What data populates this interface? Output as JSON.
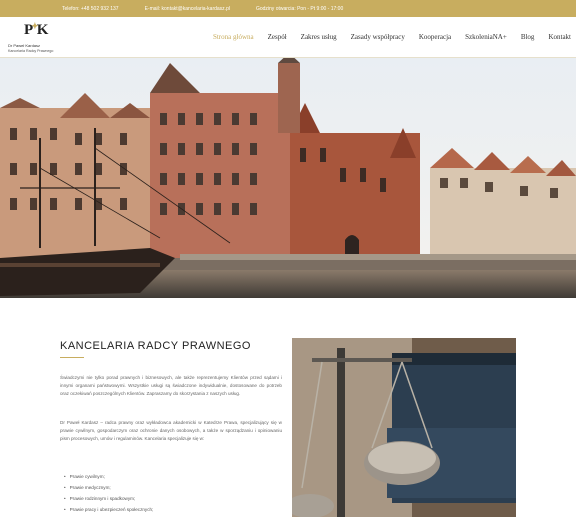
{
  "topbar": {
    "phone": "Telefon: +48 502 932 137",
    "email": "E-mail: kontakt@kancelaria-kardasz.pl",
    "hours": "Godziny otwarcia: Pon - Pt 9:00 - 17:00"
  },
  "logo": {
    "line1": "Dr Paweł Kardasz",
    "line2": "Kancelaria Radcy Prawnego"
  },
  "nav": {
    "items": [
      "Strona główna",
      "Zespół",
      "Zakres usług",
      "Zasady współpracy",
      "Kooperacja",
      "SzkoleniaNA+",
      "Blog",
      "Kontakt"
    ],
    "active_index": 0
  },
  "colors": {
    "accent": "#c8ad5f",
    "text": "#333333"
  },
  "main": {
    "title": "KANCELARIA RADCY PRAWNEGO",
    "para1": "Świadczymi nie tylko porad prawnych i biznesowych, ale także reprezentujemy Klientów przed sądami i innymi organami państwowymi. Wszystkie usługi są świadczone indywidualnie, dostosowane do potrzeb oraz oczekiwań poszczególnych Klientów. Zapraszamy do skorzystania z naszych usług.",
    "para2": "Dr Paweł Kardasz – radca prawny oraz wykładowca akademicki w Katedrze Prawa, specjalizujący się w prawie cywilnym, gospodarczym oraz ochronie danych osobowych, a także w sporządzaniu i opiniowaniu pism procesowych, umów i regulaminów. Kancelaria specjalizuje się w:",
    "list": [
      "Prawie cywilnym;",
      "Prawie medycznym;",
      "Prawie rodzinnym i spadkowym;",
      "Prawie pracy i ubezpieczeń społecznych;"
    ]
  }
}
